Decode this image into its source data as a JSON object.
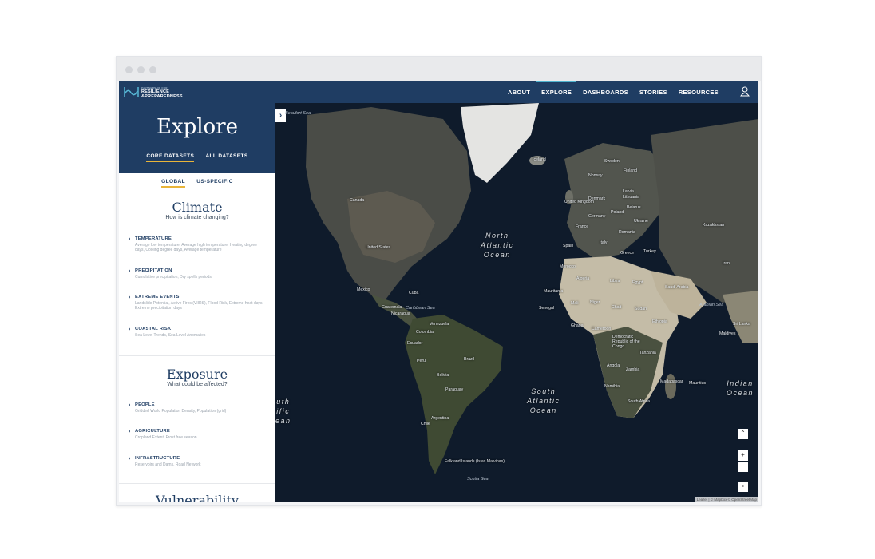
{
  "brand": {
    "line_small": "PARTNERSHIP FOR",
    "line1": "RESILIENCE",
    "line2": "&PREPAREDNESS"
  },
  "nav": {
    "items": [
      "ABOUT",
      "EXPLORE",
      "DASHBOARDS",
      "STORIES",
      "RESOURCES"
    ],
    "active": "EXPLORE",
    "user_icon": "user-icon"
  },
  "sidebar": {
    "title": "Explore",
    "dataset_tabs": [
      "CORE DATASETS",
      "ALL DATASETS"
    ],
    "scope_tabs": [
      "GLOBAL",
      "US-SPECIFIC"
    ],
    "sections": [
      {
        "title": "Climate",
        "subtitle": "How is climate changing?",
        "items": [
          {
            "title": "TEMPERATURE",
            "desc": "Average low temperature, Average high temperature, Heating degree days, Cooling degree days, Average temperature"
          },
          {
            "title": "PRECIPITATION",
            "desc": "Cumulative precipitation, Dry spells periods"
          },
          {
            "title": "EXTREME EVENTS",
            "desc": "Landslide Potential, Active Fires (VIIRS), Flood Risk, Extreme heat days, Extreme precipitation days"
          },
          {
            "title": "COASTAL RISK",
            "desc": "Sea Level Trends, Sea Level Anomalies"
          }
        ]
      },
      {
        "title": "Exposure",
        "subtitle": "What could be affected?",
        "items": [
          {
            "title": "PEOPLE",
            "desc": "Gridded World Population Density, Population (grid)"
          },
          {
            "title": "AGRICULTURE",
            "desc": "Cropland Extent, Frost free season"
          },
          {
            "title": "INFRASTRUCTURE",
            "desc": "Reservoirs and Dams, Road Network"
          }
        ]
      },
      {
        "title": "Vulnerability"
      }
    ]
  },
  "map": {
    "oceans": {
      "north_atlantic": "North\nAtlantic\nOcean",
      "south_atlantic": "South\nAtlantic\nOcean",
      "indian": "Indian\nOcean",
      "pacific_partial": "uth\nific\nean"
    },
    "seas": [
      "Arabian Sea",
      "Caribbean Sea",
      "Scotia Sea",
      "Beaufort Sea"
    ],
    "places": [
      "Canada",
      "United States",
      "Mexico",
      "Cuba",
      "Guatemala",
      "Nicaragua",
      "Venezuela",
      "Colombia",
      "Ecuador",
      "Peru",
      "Brazil",
      "Bolivia",
      "Paraguay",
      "Argentina",
      "Chile",
      "Falkland Islands (Islas Malvinas)",
      "Iceland",
      "Sweden",
      "Finland",
      "Norway",
      "Denmark",
      "United Kingdom",
      "Germany",
      "Poland",
      "Belarus",
      "Ukraine",
      "France",
      "Romania",
      "Spain",
      "Italy",
      "Greece",
      "Turkey",
      "Kazakhstan",
      "Morocco",
      "Algeria",
      "Libya",
      "Egypt",
      "Mauritania",
      "Mali",
      "Niger",
      "Chad",
      "Sudan",
      "Ethiopia",
      "Saudi Arabia",
      "Senegal",
      "Ghana",
      "Cameroon",
      "Democratic Republic of the Congo",
      "Tanzania",
      "Angola",
      "Zambia",
      "Namibia",
      "South Africa",
      "Madagascar",
      "Mauritius",
      "Maldives",
      "Sri Lanka",
      "Iran",
      "Latvia",
      "Lithuania"
    ],
    "attribution": "Leaflet | © Mapbox © OpenStreetMap",
    "toggle_icon": "chevron-right-icon",
    "controls": {
      "zoom_in": "+",
      "zoom_out": "−"
    }
  }
}
